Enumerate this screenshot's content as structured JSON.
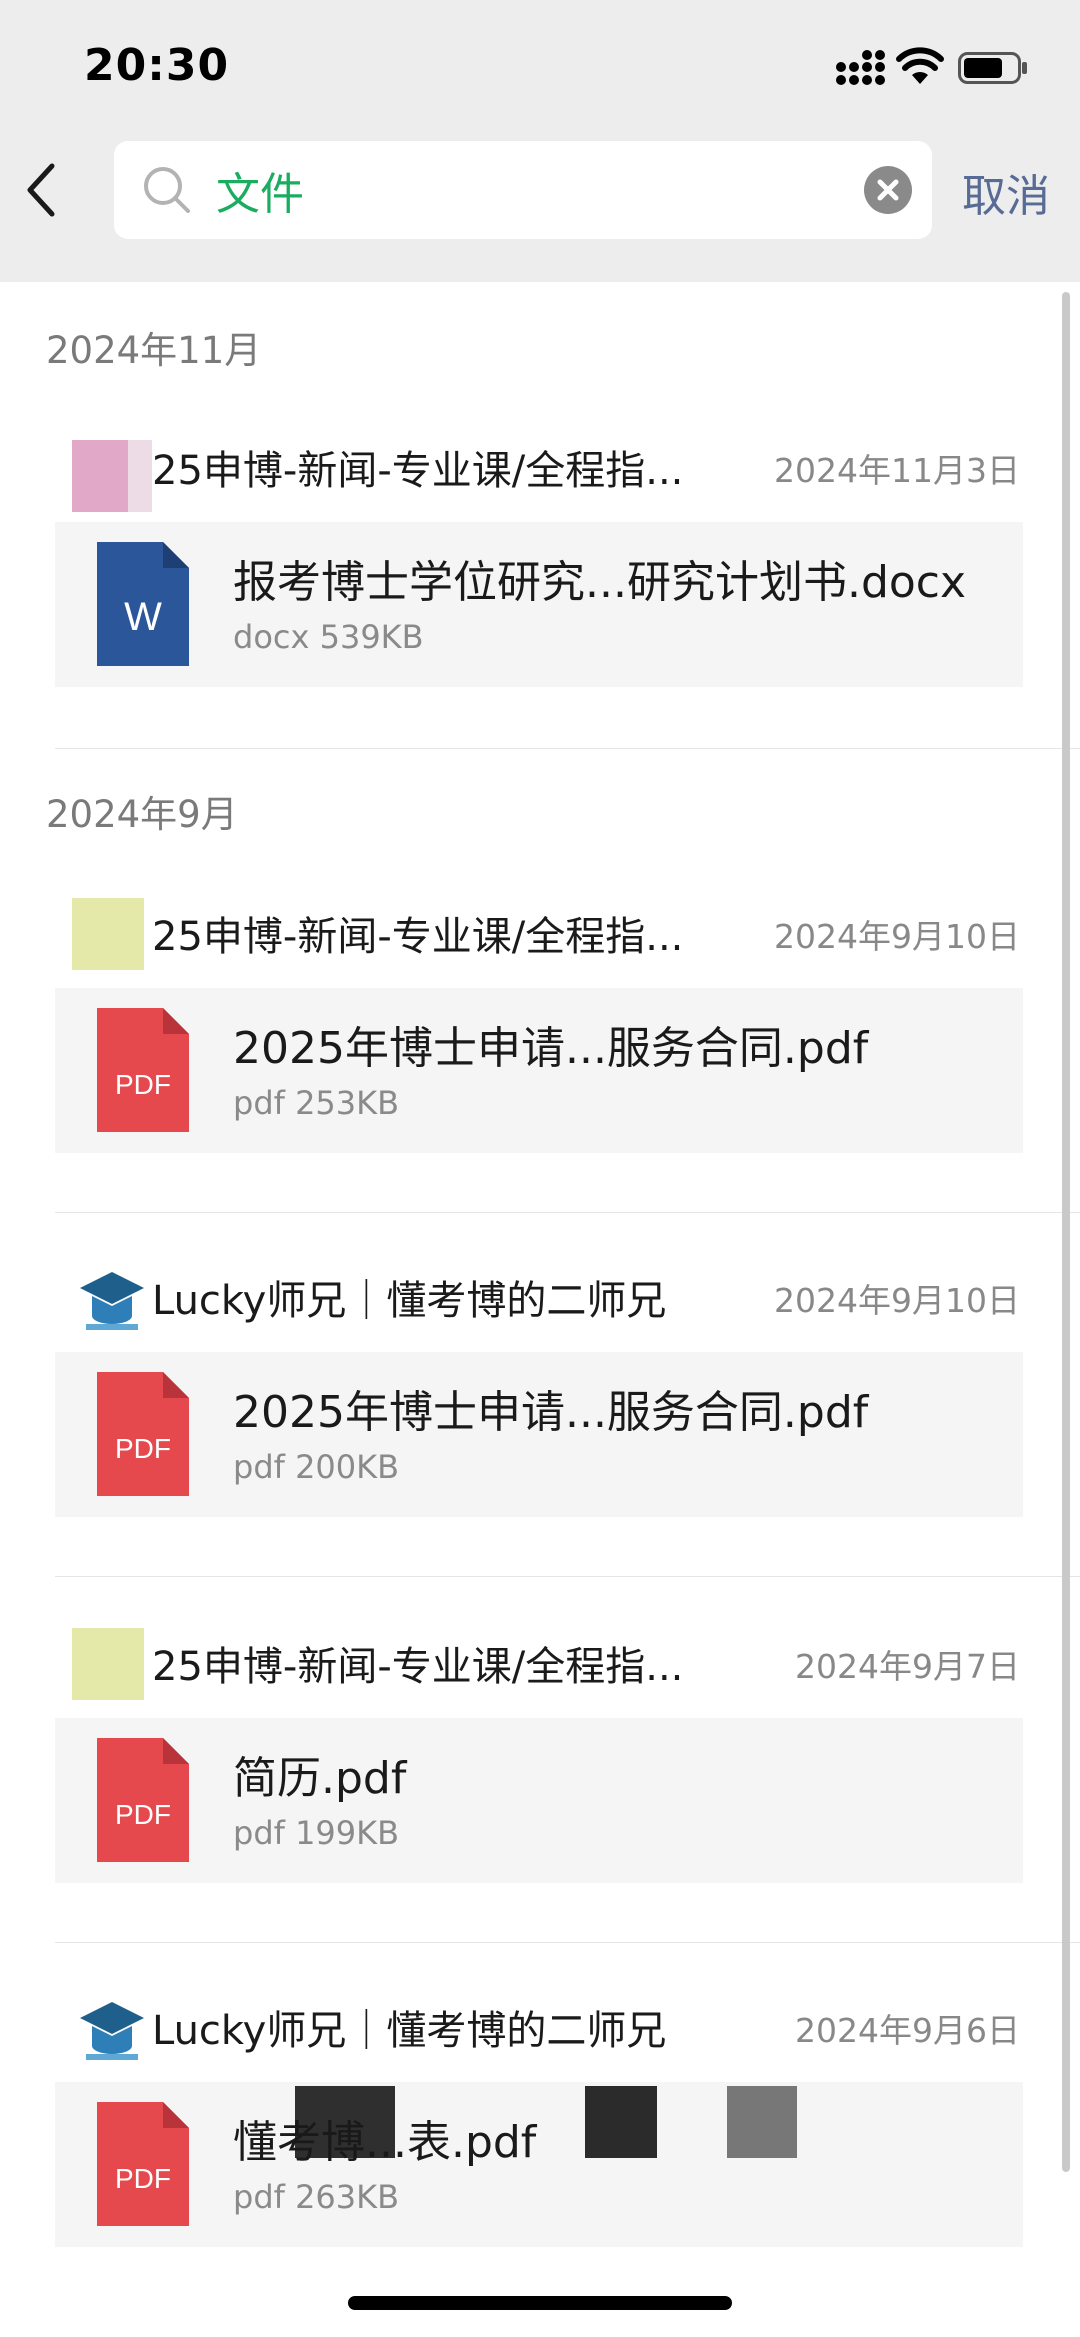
{
  "status_bar": {
    "time": "20:30"
  },
  "search": {
    "query": "文件",
    "cancel_label": "取消"
  },
  "colors": {
    "accent_green": "#1aad5f",
    "link_blue": "#576b95",
    "pdf_red": "#e5484d",
    "word_blue": "#2b579a"
  },
  "months": [
    {
      "label": "2024年11月"
    },
    {
      "label": "2024年9月"
    }
  ],
  "results": [
    {
      "source": "25申博-新闻-专业课/全程指...",
      "source_icon": "group-avatar-icon",
      "date": "2024年11月3日",
      "file_name": "报考博士学位研究...研究计划书.docx",
      "file_type": "docx",
      "file_meta": "docx 539KB",
      "file_icon": "word-file-icon"
    },
    {
      "source": "25申博-新闻-专业课/全程指...",
      "source_icon": "group-avatar-icon",
      "date": "2024年9月10日",
      "file_name": "2025年博士申请...服务合同.pdf",
      "file_type": "pdf",
      "file_meta": "pdf 253KB",
      "file_icon": "pdf-file-icon"
    },
    {
      "source": "Lucky师兄｜懂考博的二师兄",
      "source_icon": "user-avatar-icon",
      "date": "2024年9月10日",
      "file_name": "2025年博士申请...服务合同.pdf",
      "file_type": "pdf",
      "file_meta": "pdf 200KB",
      "file_icon": "pdf-file-icon"
    },
    {
      "source": "25申博-新闻-专业课/全程指...",
      "source_icon": "group-avatar-icon",
      "date": "2024年9月7日",
      "file_name": "简历.pdf",
      "file_type": "pdf",
      "file_meta": "pdf 199KB",
      "file_icon": "pdf-file-icon"
    },
    {
      "source": "Lucky师兄｜懂考博的二师兄",
      "source_icon": "user-avatar-icon",
      "date": "2024年9月6日",
      "file_name": "懂考博...表.pdf",
      "file_type": "pdf",
      "file_meta": "pdf 263KB",
      "file_icon": "pdf-file-icon"
    }
  ],
  "file_badges": {
    "word": "W",
    "pdf": "PDF"
  }
}
